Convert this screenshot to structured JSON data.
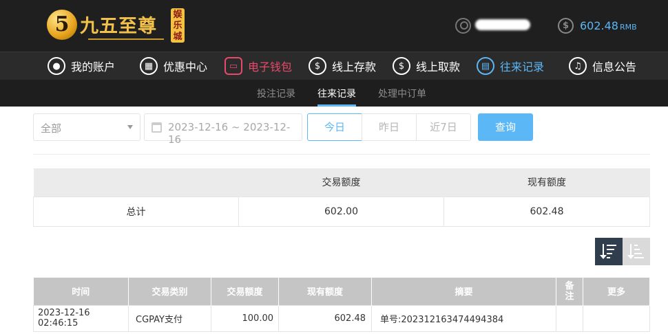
{
  "header": {
    "logo_text": "九五至尊",
    "logo_badge": "娱乐城",
    "logo_mark": "5",
    "balance_value": "602.48",
    "balance_unit": "RMB",
    "coin_symbol": "$"
  },
  "nav": [
    {
      "label": "我的账户",
      "icon": "user-icon",
      "glyph": "●"
    },
    {
      "label": "优惠中心",
      "icon": "gift-icon",
      "glyph": "▦"
    },
    {
      "label": "电子钱包",
      "icon": "wallet-icon",
      "glyph": "▭"
    },
    {
      "label": "线上存款",
      "icon": "deposit-icon",
      "glyph": "$"
    },
    {
      "label": "线上取款",
      "icon": "withdraw-icon",
      "glyph": "$"
    },
    {
      "label": "往来记录",
      "icon": "record-icon",
      "glyph": "▤"
    },
    {
      "label": "信息公告",
      "icon": "bell-icon",
      "glyph": "♫"
    }
  ],
  "subnav": [
    "投注记录",
    "往来记录",
    "处理中订单"
  ],
  "filter": {
    "type_value": "全部",
    "date_range": "2023-12-16 ~ 2023-12-16",
    "today": "今日",
    "yesterday": "昨日",
    "last7": "近7日",
    "query": "查询"
  },
  "summary": {
    "headers": [
      "",
      "交易额度",
      "现有额度"
    ],
    "row": [
      "总计",
      "602.00",
      "602.48"
    ]
  },
  "detail": {
    "headers": [
      "时间",
      "交易类别",
      "交易额度",
      "现有额度",
      "摘要",
      "备注",
      "更多"
    ],
    "rows": [
      [
        "2023-12-16 02:46:15",
        "CGPAY支付",
        "100.00",
        "602.48",
        "单号:202312163474494384",
        "",
        ""
      ]
    ]
  },
  "colors": {
    "accent": "#5bb7f5",
    "active_red": "#e84a6b",
    "gold": "#f2c14a"
  }
}
